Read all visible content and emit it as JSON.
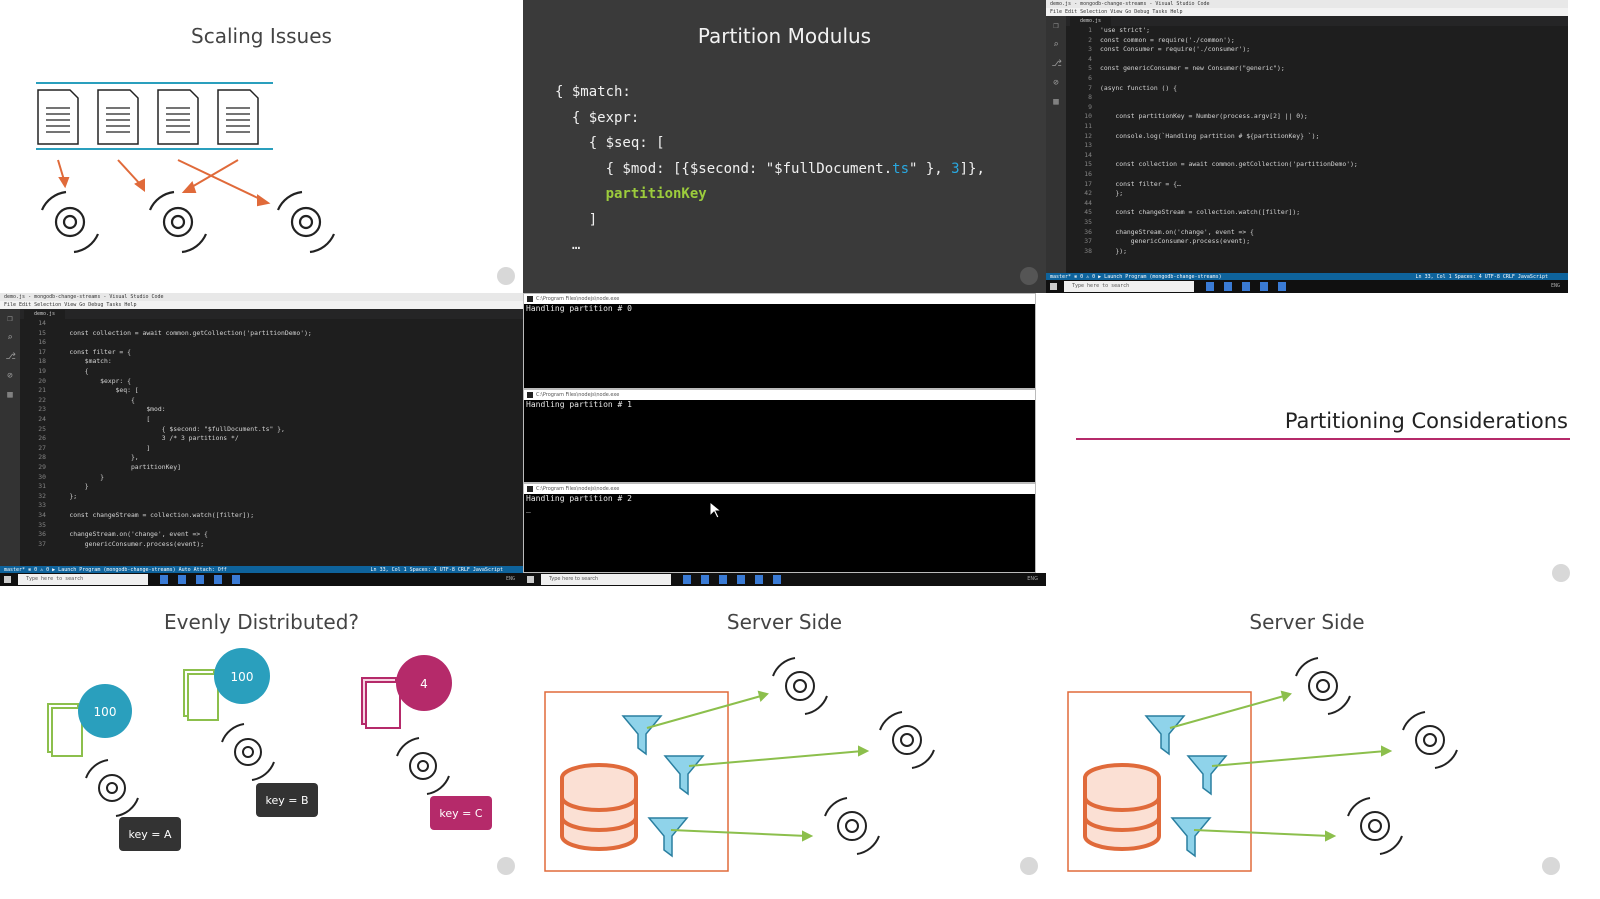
{
  "slides": {
    "scaling_issues": {
      "title": "Scaling Issues"
    },
    "partition_modulus": {
      "title": "Partition Modulus",
      "code": {
        "line1": "{ $match:",
        "line2": "{ $expr:",
        "line3": "{ $seq: [",
        "line4a": "{ $mod: [{$second: \"$fullDocument.",
        "line4b": "ts",
        "line4c": "\" }, ",
        "line4d": "3",
        "line4e": "]},",
        "line5": "partitionKey",
        "line6": "]",
        "line7": "…"
      }
    },
    "partitioning_considerations": {
      "title": "Partitioning Considerations"
    },
    "evenly_distributed": {
      "title": "Evenly Distributed?",
      "counts": [
        "100",
        "100",
        "4"
      ],
      "keys": [
        "key = A",
        "key = B",
        "key = C"
      ]
    },
    "server_side_1": {
      "title": "Server Side"
    },
    "server_side_2": {
      "title": "Server Side"
    }
  },
  "vscode_top": {
    "window_title": "demo.js - mongodb-change-streams - Visual Studio Code",
    "menu": "File  Edit  Selection  View  Go  Debug  Tasks  Help",
    "tab": "demo.js",
    "lines": [
      {
        "n": "1",
        "t": "'use strict';"
      },
      {
        "n": "2",
        "t": "const common = require('./common');"
      },
      {
        "n": "3",
        "t": "const Consumer = require('./consumer');"
      },
      {
        "n": "4",
        "t": ""
      },
      {
        "n": "5",
        "t": "const genericConsumer = new Consumer(\"generic\");"
      },
      {
        "n": "6",
        "t": ""
      },
      {
        "n": "7",
        "t": "(async function () {"
      },
      {
        "n": "8",
        "t": ""
      },
      {
        "n": "9",
        "t": ""
      },
      {
        "n": "10",
        "t": "    const partitionKey = Number(process.argv[2] || 0);"
      },
      {
        "n": "11",
        "t": ""
      },
      {
        "n": "12",
        "t": "    console.log(`Handling partition # ${partitionKey} `);"
      },
      {
        "n": "13",
        "t": ""
      },
      {
        "n": "14",
        "t": ""
      },
      {
        "n": "15",
        "t": "    const collection = await common.getCollection('partitionDemo');"
      },
      {
        "n": "16",
        "t": ""
      },
      {
        "n": "17",
        "t": "    const filter = {…"
      },
      {
        "n": "42",
        "t": "    };"
      },
      {
        "n": "44",
        "t": ""
      },
      {
        "n": "45",
        "t": "    const changeStream = collection.watch([filter]);"
      },
      {
        "n": "35",
        "t": ""
      },
      {
        "n": "36",
        "t": "    changeStream.on('change', event => {"
      },
      {
        "n": "37",
        "t": "        genericConsumer.process(event);"
      },
      {
        "n": "38",
        "t": "    });"
      }
    ],
    "status_left": "master*   ⊗ 0 ⚠ 0   ▶ Launch Program (mongodb-change-streams)",
    "status_right": "Ln 33, Col 1   Spaces: 4   UTF-8   CRLF   JavaScript",
    "search_placeholder": "Type here to search",
    "tray": "ENG"
  },
  "vscode_mid": {
    "window_title": "demo.js - mongodb-change-streams - Visual Studio Code",
    "menu": "File  Edit  Selection  View  Go  Debug  Tasks  Help",
    "tab": "demo.js",
    "lines": [
      {
        "n": "14",
        "t": ""
      },
      {
        "n": "15",
        "t": "    const collection = await common.getCollection('partitionDemo');"
      },
      {
        "n": "16",
        "t": ""
      },
      {
        "n": "17",
        "t": "    const filter = {"
      },
      {
        "n": "18",
        "t": "        $match:"
      },
      {
        "n": "19",
        "t": "        {"
      },
      {
        "n": "20",
        "t": "            $expr: {"
      },
      {
        "n": "21",
        "t": "                $eq: ["
      },
      {
        "n": "22",
        "t": "                    {"
      },
      {
        "n": "23",
        "t": "                        $mod:"
      },
      {
        "n": "24",
        "t": "                        ["
      },
      {
        "n": "25",
        "t": "                            { $second: \"$fullDocument.ts\" },"
      },
      {
        "n": "26",
        "t": "                            3 /* 3 partitions */"
      },
      {
        "n": "27",
        "t": "                        ]"
      },
      {
        "n": "28",
        "t": "                    },"
      },
      {
        "n": "29",
        "t": "                    partitionKey]"
      },
      {
        "n": "30",
        "t": "            }"
      },
      {
        "n": "31",
        "t": "        }"
      },
      {
        "n": "32",
        "t": "    };"
      },
      {
        "n": "33",
        "t": ""
      },
      {
        "n": "34",
        "t": "    const changeStream = collection.watch([filter]);"
      },
      {
        "n": "35",
        "t": ""
      },
      {
        "n": "36",
        "t": "    changeStream.on('change', event => {"
      },
      {
        "n": "37",
        "t": "        genericConsumer.process(event);"
      }
    ],
    "status_left": "master*   ⊗ 0 ⚠ 0   ▶ Launch Program (mongodb-change-streams)   Auto Attach: Off",
    "status_right": "Ln 33, Col 1   Spaces: 4   UTF-8   CRLF   JavaScript",
    "search_placeholder": "Type here to search",
    "tray": "ENG"
  },
  "consoles": {
    "window_title": "C:\\Program Files\\nodejs\\node.exe",
    "outputs": [
      "Handling partition # 0",
      "Handling partition # 1",
      "Handling partition # 2"
    ],
    "search_placeholder": "Type here to search",
    "tray": "ENG"
  },
  "colors": {
    "teal": "#2a9fbd",
    "crimson": "#b52a6a",
    "orange": "#e06a3a",
    "green_line": "#8cbf4c",
    "light_blue": "#8fd3ea"
  }
}
